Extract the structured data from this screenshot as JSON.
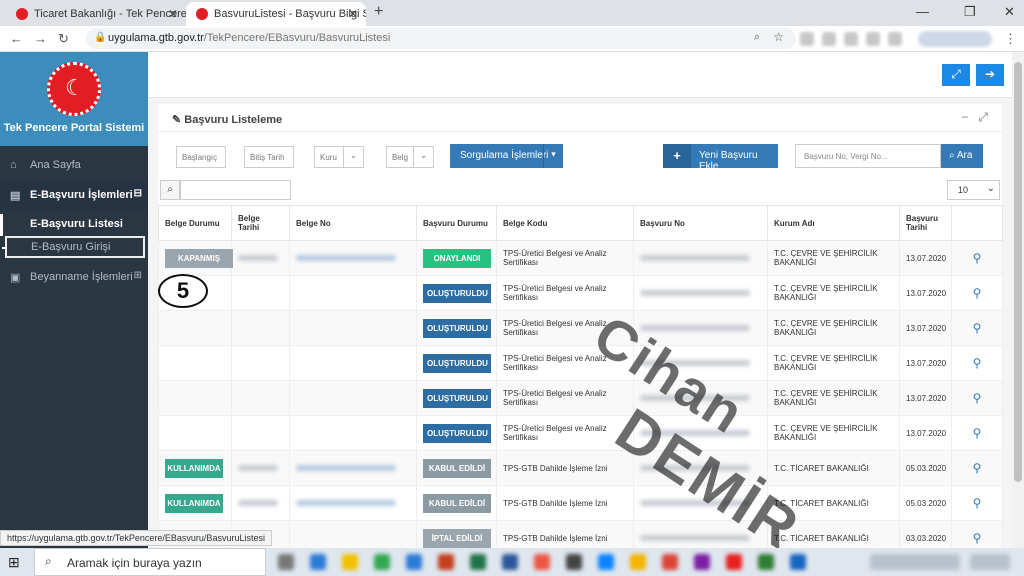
{
  "browser": {
    "tabs": [
      {
        "title": "Ticaret Bakanlığı - Tek Pencere"
      },
      {
        "title": "BasvuruListesi - Başvuru Bilgi Sist"
      }
    ],
    "url_host": "uygulama.gtb.gov.tr",
    "url_path": "/TekPencere/EBasvuru/BasvuruListesi",
    "status_url": "https://uygulama.gtb.gov.tr/TekPencere/EBasvuru/BasvuruListesi"
  },
  "sidebar": {
    "title": "Tek Pencere Portal Sistemi",
    "items": [
      {
        "label": "Ana Sayfa"
      },
      {
        "label": "E-Başvuru İşlemleri"
      },
      {
        "label": "E-Başvuru Listesi"
      },
      {
        "label": "E-Başvuru Girişi"
      },
      {
        "label": "Beyanname İşlemleri"
      }
    ]
  },
  "portlet": {
    "title": "Başvuru Listeleme",
    "filters": {
      "start_date": "Başlangıç",
      "end_date": "Bitiş Tarih",
      "institution": "Kuru",
      "document": "Belg"
    },
    "query_button": "Sorgulama İşlemleri",
    "new_button": "Yeni Başvuru Ekle",
    "search_placeholder": "Başvuru No, Vergi No...",
    "search_button": "Ara",
    "page_size": "10"
  },
  "table": {
    "headers": [
      "Belge Durumu",
      "Belge Tarihi",
      "Belge No",
      "Başvuru Durumu",
      "Belge Kodu",
      "Başvuru No",
      "Kurum Adı",
      "Başvuru Tarihi",
      ""
    ],
    "rows": [
      {
        "belge_durumu": "KAPANMIŞ",
        "basvuru_durumu": "ONAYLANDI",
        "belge_kodu": "TPS-Üretici Belgesi ve Analiz Sertifikası",
        "kurum": "T.C. ÇEVRE VE ŞEHİRCİLİK BAKANLIĞI",
        "tarih": "13.07.2020"
      },
      {
        "belge_durumu": "",
        "basvuru_durumu": "OLUŞTURULDU",
        "belge_kodu": "TPS-Üretici Belgesi ve Analiz Sertifikası",
        "kurum": "T.C. ÇEVRE VE ŞEHİRCİLİK BAKANLIĞI",
        "tarih": "13.07.2020"
      },
      {
        "belge_durumu": "",
        "basvuru_durumu": "OLUŞTURULDU",
        "belge_kodu": "TPS-Üretici Belgesi ve Analiz Sertifikası",
        "kurum": "T.C. ÇEVRE VE ŞEHİRCİLİK BAKANLIĞI",
        "tarih": "13.07.2020"
      },
      {
        "belge_durumu": "",
        "basvuru_durumu": "OLUŞTURULDU",
        "belge_kodu": "TPS-Üretici Belgesi ve Analiz Sertifikası",
        "kurum": "T.C. ÇEVRE VE ŞEHİRCİLİK BAKANLIĞI",
        "tarih": "13.07.2020"
      },
      {
        "belge_durumu": "",
        "basvuru_durumu": "OLUŞTURULDU",
        "belge_kodu": "TPS-Üretici Belgesi ve Analiz Sertifikası",
        "kurum": "T.C. ÇEVRE VE ŞEHİRCİLİK BAKANLIĞI",
        "tarih": "13.07.2020"
      },
      {
        "belge_durumu": "",
        "basvuru_durumu": "OLUŞTURULDU",
        "belge_kodu": "TPS-Üretici Belgesi ve Analiz Sertifikası",
        "kurum": "T.C. ÇEVRE VE ŞEHİRCİLİK BAKANLIĞI",
        "tarih": "13.07.2020"
      },
      {
        "belge_durumu": "KULLANIMDA",
        "basvuru_durumu": "KABUL EDİLDİ",
        "belge_kodu": "TPS-GTB Dahilde İşleme İzni",
        "kurum": "T.C. TİCARET BAKANLIĞI",
        "tarih": "05.03.2020"
      },
      {
        "belge_durumu": "KULLANIMDA",
        "basvuru_durumu": "KABUL EDİLDİ",
        "belge_kodu": "TPS-GTB Dahilde İşleme İzni",
        "kurum": "T.C. TİCARET BAKANLIĞI",
        "tarih": "05.03.2020"
      },
      {
        "belge_durumu": "",
        "basvuru_durumu": "İPTAL EDİLDİ",
        "belge_kodu": "TPS-GTB Dahilde İşleme İzni",
        "kurum": "T.C. TİCARET BAKANLIĞI",
        "tarih": "03.03.2020"
      }
    ]
  },
  "annotation_number": "5",
  "watermark": {
    "line1": "Cihan",
    "line2": "DEMİR"
  },
  "taskbar": {
    "search_placeholder": "Aramak için buraya yazın"
  }
}
